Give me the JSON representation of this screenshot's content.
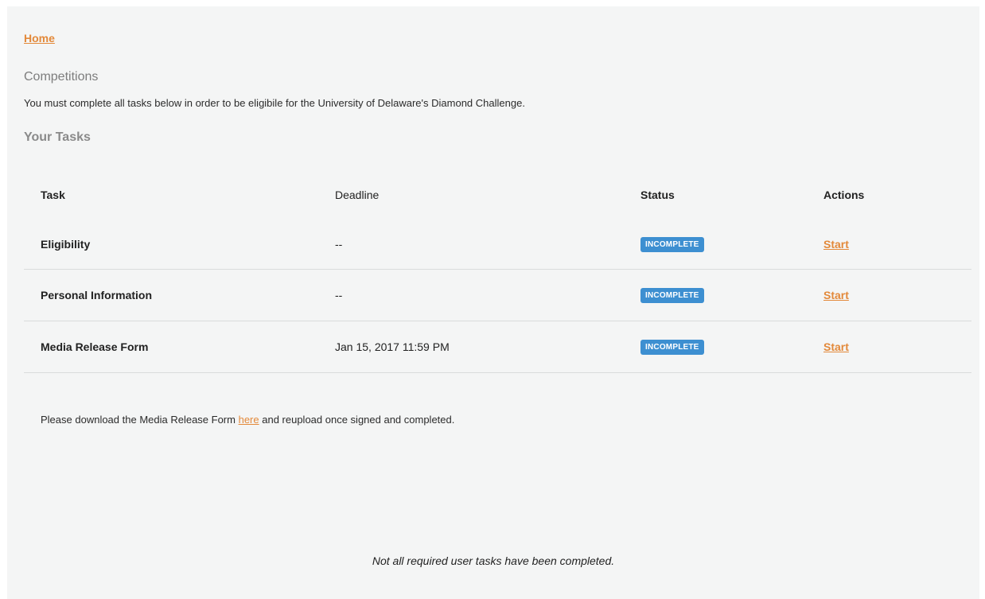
{
  "nav": {
    "home_label": "Home"
  },
  "section": {
    "title": "Competitions",
    "intro": "You must complete all tasks below in order to be eligibile for the University of Delaware's Diamond Challenge."
  },
  "tasks": {
    "heading": "Your Tasks",
    "columns": {
      "task": "Task",
      "deadline": "Deadline",
      "status": "Status",
      "actions": "Actions"
    },
    "rows": [
      {
        "task": "Eligibility",
        "deadline": "--",
        "status": "INCOMPLETE",
        "action": "Start"
      },
      {
        "task": "Personal Information",
        "deadline": "--",
        "status": "INCOMPLETE",
        "action": "Start"
      },
      {
        "task": "Media Release Form",
        "deadline": "Jan 15, 2017 11:59 PM",
        "status": "INCOMPLETE",
        "action": "Start"
      }
    ]
  },
  "note": {
    "before": "Please download the Media Release Form ",
    "link": "here",
    "after": " and reupload once signed and completed."
  },
  "footer": {
    "message": "Not all required user tasks have been completed."
  },
  "colors": {
    "accent": "#e3893a",
    "badge": "#3d8fd1",
    "background": "#f4f5f5"
  }
}
